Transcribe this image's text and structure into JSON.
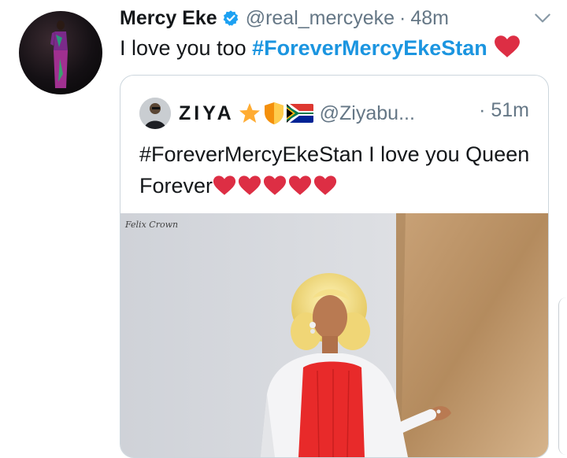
{
  "tweet": {
    "author_name": "Mercy Eke",
    "handle": "@real_mercyeke",
    "separator": "·",
    "time": "48m",
    "text_prefix": "I love you too ",
    "hashtag": "#ForeverMercyEkeStan",
    "verified_color": "#1da1f2",
    "heart_color": "#dd2e44"
  },
  "quote": {
    "author_name": "ZIYA",
    "handle": "@Ziyabu...",
    "separator": "·",
    "time": "51m",
    "text": "#ForeverMercyEkeStan I love you Queen Forever",
    "heart_count": 5,
    "photo_signature": "Felix Crown"
  },
  "icons": [
    "verified-badge-icon",
    "chevron-down-icon",
    "heart-icon",
    "star-icon",
    "shield-icon",
    "south-africa-flag-icon"
  ]
}
